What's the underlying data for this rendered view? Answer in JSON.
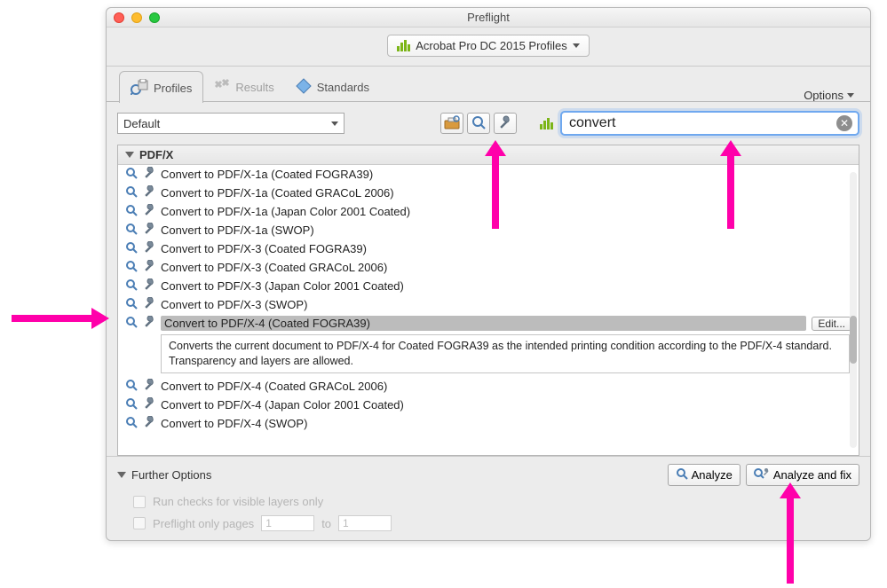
{
  "window": {
    "title": "Preflight"
  },
  "profile_selector": {
    "label": "Acrobat Pro DC 2015 Profiles"
  },
  "tabs": {
    "profiles": "Profiles",
    "results": "Results",
    "standards": "Standards"
  },
  "options_label": "Options",
  "toolbar": {
    "dropdown_value": "Default"
  },
  "search": {
    "value": "convert"
  },
  "category": {
    "name": "PDF/X"
  },
  "items": [
    {
      "label": "Convert to PDF/X-1a (Coated FOGRA39)"
    },
    {
      "label": "Convert to PDF/X-1a (Coated GRACoL 2006)"
    },
    {
      "label": "Convert to PDF/X-1a (Japan Color 2001 Coated)"
    },
    {
      "label": "Convert to PDF/X-1a (SWOP)"
    },
    {
      "label": "Convert to PDF/X-3 (Coated FOGRA39)"
    },
    {
      "label": "Convert to PDF/X-3 (Coated GRACoL 2006)"
    },
    {
      "label": "Convert to PDF/X-3 (Japan Color 2001 Coated)"
    },
    {
      "label": "Convert to PDF/X-3 (SWOP)"
    },
    {
      "label": "Convert to PDF/X-4 (Coated FOGRA39)",
      "selected": true,
      "description": "Converts the current document to PDF/X-4 for Coated FOGRA39 as the intended printing condition according to the PDF/X-4 standard. Transparency and layers are allowed.",
      "edit_label": "Edit..."
    },
    {
      "label": "Convert to PDF/X-4 (Coated GRACoL 2006)"
    },
    {
      "label": "Convert to PDF/X-4 (Japan Color 2001 Coated)"
    },
    {
      "label": "Convert to PDF/X-4 (SWOP)"
    }
  ],
  "footer": {
    "further_label": "Further Options",
    "analyze_label": "Analyze",
    "analyze_fix_label": "Analyze and fix",
    "run_checks_label": "Run checks for visible layers only",
    "preflight_pages_label": "Preflight only pages",
    "page_from": "1",
    "page_to_label": "to",
    "page_to": "1"
  }
}
